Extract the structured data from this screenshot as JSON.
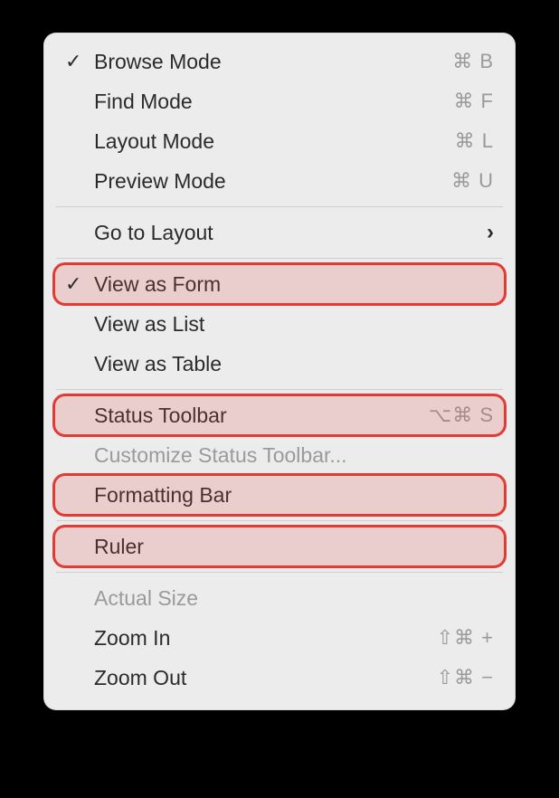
{
  "menu": {
    "modes": [
      {
        "label": "Browse Mode",
        "shortcut": "⌘ B",
        "checked": true
      },
      {
        "label": "Find Mode",
        "shortcut": "⌘ F",
        "checked": false
      },
      {
        "label": "Layout Mode",
        "shortcut": "⌘ L",
        "checked": false
      },
      {
        "label": "Preview Mode",
        "shortcut": "⌘ U",
        "checked": false
      }
    ],
    "go_to_layout": {
      "label": "Go to Layout",
      "submenu": true
    },
    "views": [
      {
        "label": "View as Form",
        "checked": true,
        "highlight": true
      },
      {
        "label": "View as List",
        "checked": false,
        "highlight": false
      },
      {
        "label": "View as Table",
        "checked": false,
        "highlight": false
      }
    ],
    "toolbar": [
      {
        "label": "Status Toolbar",
        "shortcut": "⌥⌘ S",
        "highlight": true,
        "disabled": false
      },
      {
        "label": "Customize Status Toolbar...",
        "shortcut": "",
        "highlight": false,
        "disabled": true
      },
      {
        "label": "Formatting Bar",
        "shortcut": "",
        "highlight": true,
        "disabled": false
      }
    ],
    "ruler": {
      "label": "Ruler",
      "highlight": true
    },
    "zoom": [
      {
        "label": "Actual Size",
        "shortcut": "",
        "disabled": true
      },
      {
        "label": "Zoom In",
        "shortcut": "⇧⌘ +",
        "disabled": false
      },
      {
        "label": "Zoom Out",
        "shortcut": "⇧⌘ −",
        "disabled": false
      }
    ]
  },
  "glyphs": {
    "check": "✓",
    "chevron": "›"
  }
}
